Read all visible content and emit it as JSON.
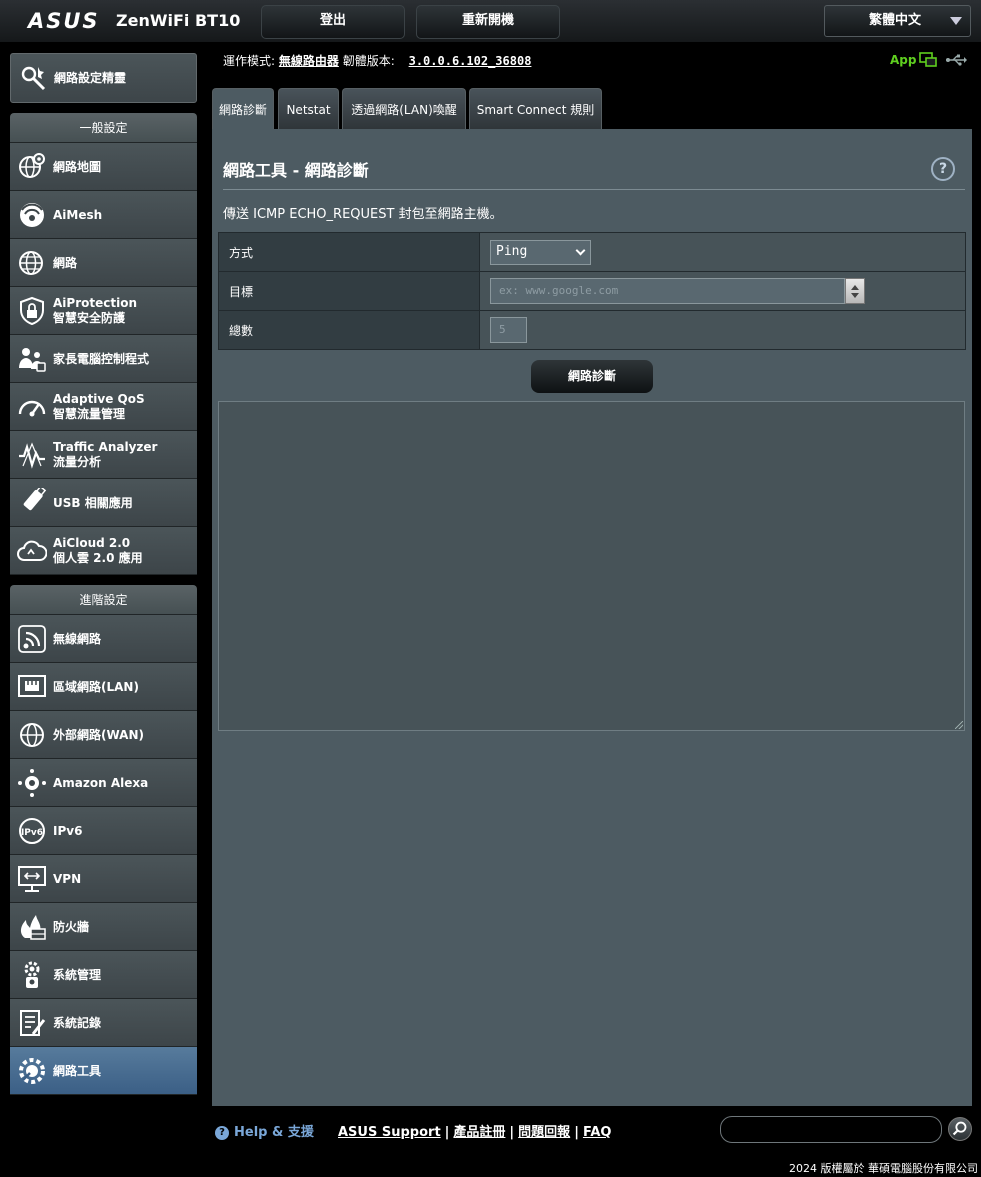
{
  "header": {
    "brand": "ASUS",
    "model": "ZenWiFi BT10",
    "logout_label": "登出",
    "reboot_label": "重新開機",
    "language": "繁體中文"
  },
  "status": {
    "mode_label": "運作模式:",
    "mode_value": "無線路由器",
    "firmware_label": "韌體版本:",
    "firmware_value": "3.0.0.6.102_36808",
    "app_label": "App"
  },
  "sidebar": {
    "wizard": {
      "label": "網路設定精靈",
      "icon": "wizard-icon"
    },
    "general": {
      "title": "一般設定",
      "items": [
        {
          "line1": "網路地圖",
          "line2": "",
          "icon": "network-map-icon"
        },
        {
          "line1": "AiMesh",
          "line2": "",
          "icon": "aimesh-icon"
        },
        {
          "line1": "網路",
          "line2": "",
          "icon": "globe-icon"
        },
        {
          "line1": "AiProtection",
          "line2": "智慧安全防護",
          "icon": "shield-lock-icon"
        },
        {
          "line1": "家長電腦控制程式",
          "line2": "",
          "icon": "family-icon"
        },
        {
          "line1": "Adaptive QoS",
          "line2": "智慧流量管理",
          "icon": "gauge-icon"
        },
        {
          "line1": "Traffic Analyzer",
          "line2": "流量分析",
          "icon": "traffic-icon"
        },
        {
          "line1": "USB 相關應用",
          "line2": "",
          "icon": "usb-stick-icon"
        },
        {
          "line1": "AiCloud 2.0",
          "line2": "個人雲 2.0 應用",
          "icon": "cloud-icon"
        }
      ]
    },
    "advanced": {
      "title": "進階設定",
      "items": [
        {
          "line1": "無線網路",
          "line2": "",
          "icon": "wifi-icon"
        },
        {
          "line1": "區域網路(LAN)",
          "line2": "",
          "icon": "lan-icon"
        },
        {
          "line1": "外部網路(WAN)",
          "line2": "",
          "icon": "wan-globe-icon"
        },
        {
          "line1": "Amazon Alexa",
          "line2": "",
          "icon": "alexa-icon"
        },
        {
          "line1": "IPv6",
          "line2": "",
          "icon": "ipv6-icon"
        },
        {
          "line1": "VPN",
          "line2": "",
          "icon": "vpn-icon"
        },
        {
          "line1": "防火牆",
          "line2": "",
          "icon": "firewall-icon"
        },
        {
          "line1": "系統管理",
          "line2": "",
          "icon": "admin-icon"
        },
        {
          "line1": "系統記錄",
          "line2": "",
          "icon": "log-icon"
        },
        {
          "line1": "網路工具",
          "line2": "",
          "icon": "tools-icon"
        }
      ]
    }
  },
  "tabs": [
    {
      "label": "網路診斷"
    },
    {
      "label": "Netstat"
    },
    {
      "label": "透過網路(LAN)喚醒"
    },
    {
      "label": "Smart Connect 規則"
    }
  ],
  "main": {
    "title": "網路工具 - 網路診斷",
    "help": "?",
    "description": "傳送 ICMP ECHO_REQUEST 封包至網路主機。",
    "method_label": "方式",
    "method_value": "Ping",
    "target_label": "目標",
    "target_placeholder": "ex: www.google.com",
    "count_label": "總數",
    "count_placeholder": "5",
    "diagnose_label": "網路診斷"
  },
  "footer": {
    "help_label": "Help & 支援",
    "links": [
      "ASUS Support",
      "產品註冊",
      "問題回報",
      "FAQ"
    ],
    "copyright": "2024 版權屬於 華碩電腦股份有限公司"
  },
  "colors": {
    "accent": "#5fcf1f",
    "active_item": "#3b5f86",
    "panel": "#4d5b62"
  }
}
